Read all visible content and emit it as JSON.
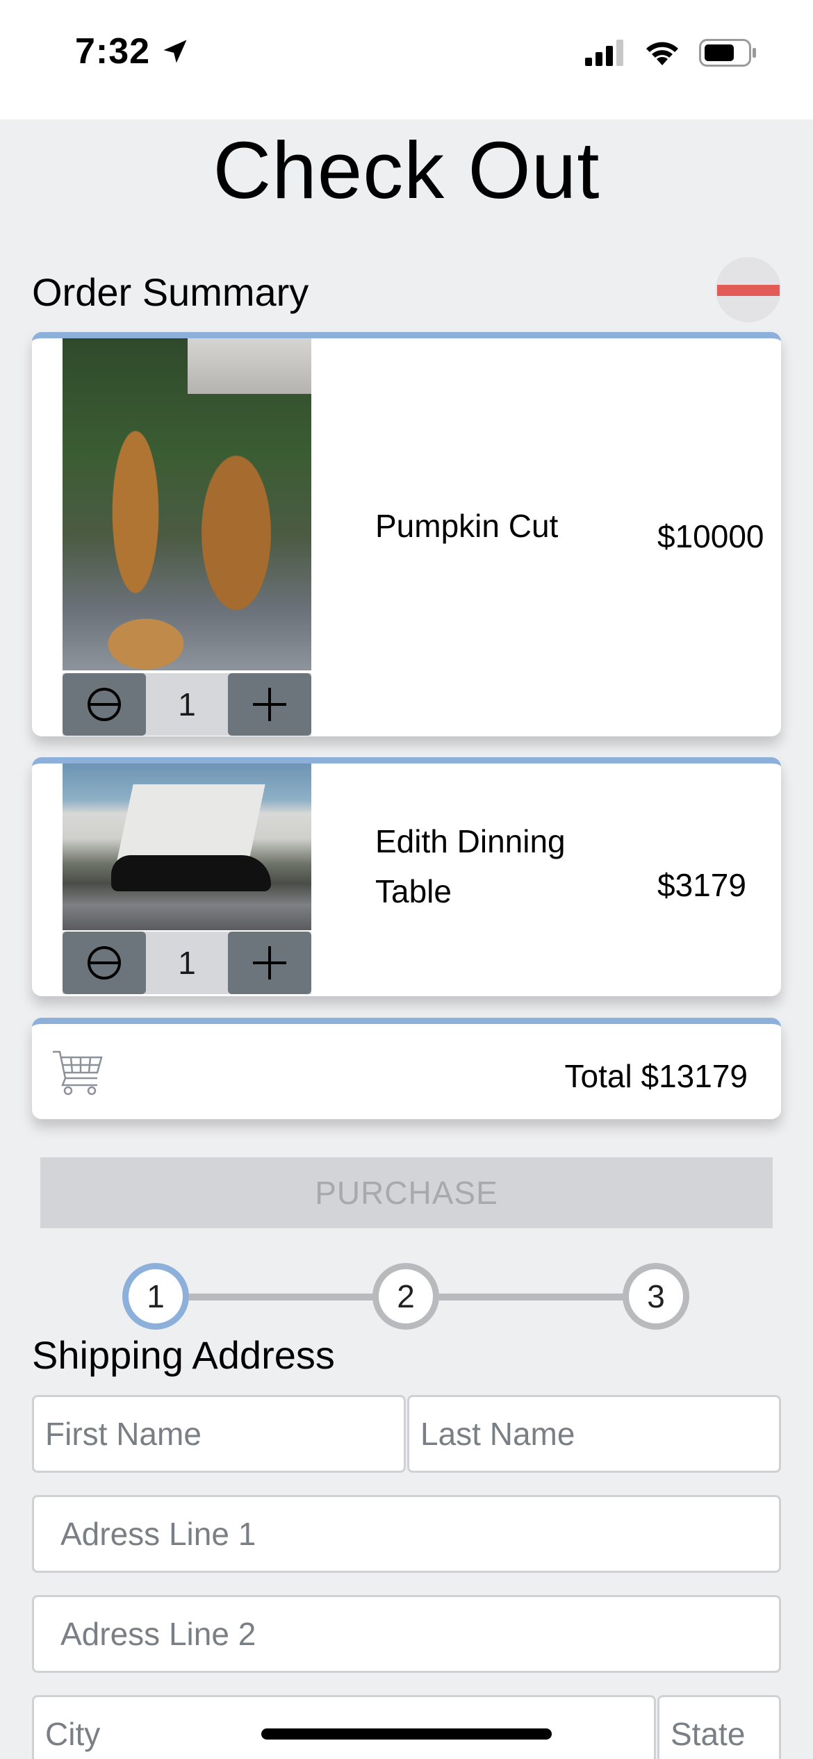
{
  "status_bar": {
    "time": "7:32"
  },
  "page": {
    "title": "Check Out"
  },
  "order_summary": {
    "heading": "Order Summary",
    "items": [
      {
        "name": "Pumpkin Cut",
        "price": "$10000",
        "quantity": "1"
      },
      {
        "name": "Edith Dinning Table",
        "price": "$3179",
        "quantity": "1"
      }
    ],
    "total": "Total $13179"
  },
  "purchase": {
    "label": "PURCHASE"
  },
  "stepper": {
    "steps": [
      "1",
      "2",
      "3"
    ],
    "active": "1"
  },
  "shipping": {
    "heading": "Shipping Address",
    "first_name_placeholder": "First Name",
    "last_name_placeholder": "Last Name",
    "address1_placeholder": "Adress Line 1",
    "address2_placeholder": "Adress Line 2",
    "city_placeholder": "City",
    "state_placeholder": "State"
  },
  "colors": {
    "accent": "#8cb0da",
    "collapse": "#e25b57",
    "qty_button": "#6c747c"
  },
  "icons": [
    "location-arrow-icon",
    "signal-icon",
    "wifi-icon",
    "battery-icon",
    "minus-circle-icon",
    "plus-icon",
    "cart-icon"
  ]
}
